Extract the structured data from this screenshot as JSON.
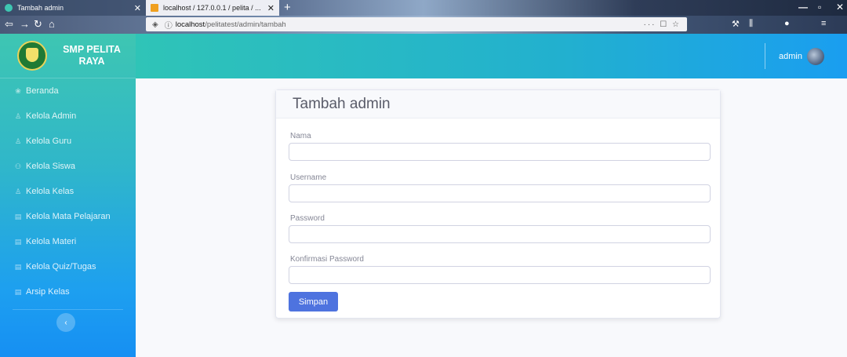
{
  "browser": {
    "tabs": [
      {
        "title": "Tambah admin",
        "favicon_color": "#3ec6b2"
      },
      {
        "title": "localhost / 127.0.0.1 / pelita / ...",
        "favicon_color": "#f0a020"
      }
    ],
    "new_tab": "+",
    "url": {
      "scheme_host": "localhost",
      "path": "/pelitatest/admin/tambah",
      "actions": "··· ☐ ☆"
    }
  },
  "sidebar": {
    "brand": "SMP PELITA RAYA",
    "items": [
      {
        "label": "Beranda",
        "icon": "home-icon",
        "glyph": "❀"
      },
      {
        "label": "Kelola Admin",
        "icon": "user-icon",
        "glyph": "♙"
      },
      {
        "label": "Kelola Guru",
        "icon": "user-icon",
        "glyph": "♙"
      },
      {
        "label": "Kelola Siswa",
        "icon": "users-icon",
        "glyph": "⚇"
      },
      {
        "label": "Kelola Kelas",
        "icon": "user-icon",
        "glyph": "♙"
      },
      {
        "label": "Kelola Mata Pelajaran",
        "icon": "book-icon",
        "glyph": "▤"
      },
      {
        "label": "Kelola Materi",
        "icon": "book-icon",
        "glyph": "▤"
      },
      {
        "label": "Kelola Quiz/Tugas",
        "icon": "book-icon",
        "glyph": "▤"
      },
      {
        "label": "Arsip Kelas",
        "icon": "book-icon",
        "glyph": "▤"
      }
    ],
    "toggle": "‹"
  },
  "topbar": {
    "user_name": "admin"
  },
  "form": {
    "title": "Tambah admin",
    "fields": [
      {
        "label": "Nama",
        "value": ""
      },
      {
        "label": "Username",
        "value": ""
      },
      {
        "label": "Password",
        "value": ""
      },
      {
        "label": "Konfirmasi Password",
        "value": ""
      }
    ],
    "submit": "Simpan"
  },
  "colors": {
    "accent": "#4e73df",
    "sidebar_top": "#3ec6b2",
    "sidebar_bottom": "#168ff3"
  }
}
